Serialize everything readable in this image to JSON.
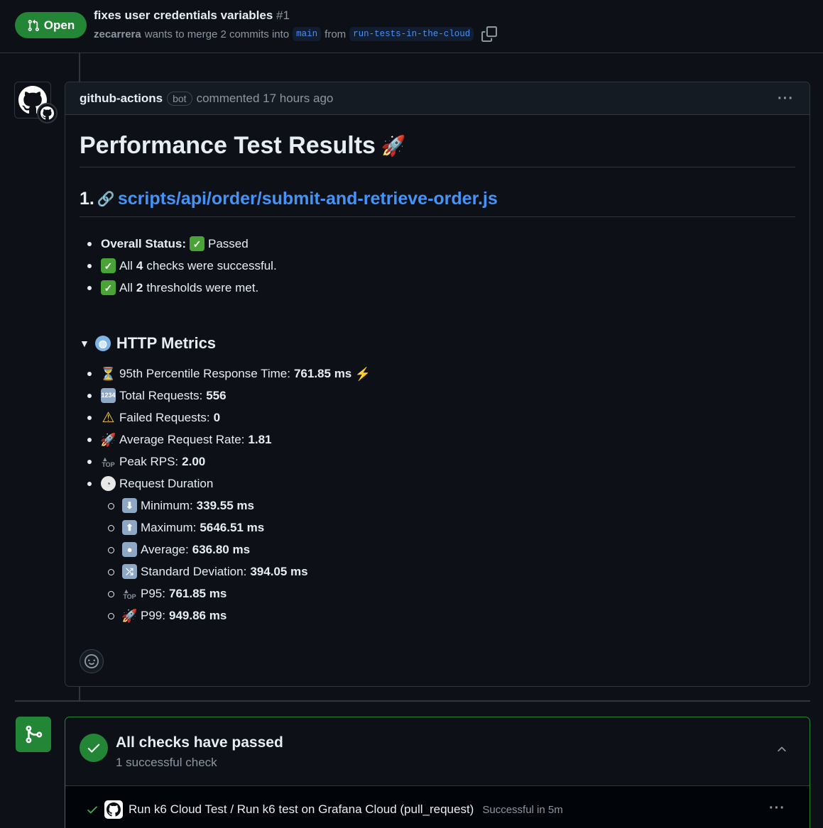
{
  "pr": {
    "state": "Open",
    "title": "fixes user credentials variables",
    "number": "#1",
    "author": "zecarrera",
    "merge_text": "wants to merge 2 commits into",
    "base_branch": "main",
    "from_text": "from",
    "head_branch": "run-tests-in-the-cloud"
  },
  "comment": {
    "author": "github-actions",
    "badge": "bot",
    "action_time": "commented 17 hours ago",
    "title": "Performance Test Results",
    "script_prefix": "1.",
    "script_link": "scripts/api/order/submit-and-retrieve-order.js",
    "status": {
      "label": "Overall Status:",
      "value": "Passed",
      "checks_pre": "All",
      "checks_count": "4",
      "checks_post": "checks were successful.",
      "thresholds_pre": "All",
      "thresholds_count": "2",
      "thresholds_post": "thresholds were met."
    },
    "http_metrics": {
      "title": "HTTP Metrics",
      "p95_label": "95th Percentile Response Time:",
      "p95_value": "761.85 ms",
      "total_label": "Total Requests:",
      "total_value": "556",
      "failed_label": "Failed Requests:",
      "failed_value": "0",
      "avg_rate_label": "Average Request Rate:",
      "avg_rate_value": "1.81",
      "peak_label": "Peak RPS:",
      "peak_value": "2.00",
      "duration_label": "Request Duration",
      "duration": [
        {
          "icon": "arrow-down-emoji",
          "label": "Minimum:",
          "value": "339.55 ms"
        },
        {
          "icon": "arrow-up-emoji",
          "label": "Maximum:",
          "value": "5646.51 ms"
        },
        {
          "icon": "record-button-emoji",
          "label": "Average:",
          "value": "636.80 ms"
        },
        {
          "icon": "shuffle-emoji",
          "label": "Standard Deviation:",
          "value": "394.05 ms"
        },
        {
          "icon": "top-arrow-emoji",
          "label": "P95:",
          "value": "761.85 ms"
        },
        {
          "icon": "rocket-emoji",
          "label": "P99:",
          "value": "949.86 ms"
        }
      ]
    }
  },
  "checks": {
    "title": "All checks have passed",
    "subtitle": "1 successful check",
    "run_name": "Run k6 Cloud Test / Run k6 test on Grafana Cloud (pull_request)",
    "run_status": "Successful in 5m"
  },
  "colors": {
    "background": "#0d1117",
    "accent_green": "#238636",
    "link_blue": "#4493f8",
    "muted": "#8d96a0"
  }
}
